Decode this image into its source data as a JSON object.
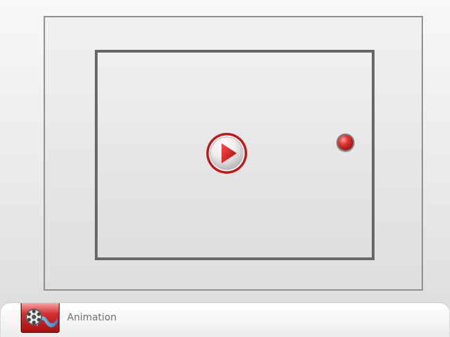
{
  "footer": {
    "label": "Animation"
  },
  "icons": {
    "play": "play-icon",
    "record": "record-icon",
    "animation": "film-reel-icon"
  },
  "colors": {
    "accent_red": "#c91818",
    "frame_gray": "#676767",
    "text_gray": "#6f6f6f"
  }
}
